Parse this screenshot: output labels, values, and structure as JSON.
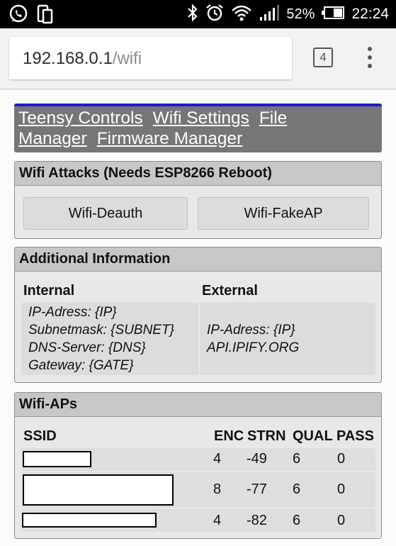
{
  "status_bar": {
    "left_icons": [
      "whatsapp-icon",
      "phone-device-icon"
    ],
    "right_icons": [
      "bluetooth-icon",
      "alarm-icon",
      "wifi-icon",
      "signal-icon"
    ],
    "battery_percent": "52%",
    "battery_level": 0.52,
    "time": "22:24"
  },
  "browser": {
    "url_host": "192.168.0.1",
    "url_path": "/wifi",
    "tab_count": "4"
  },
  "nav": {
    "links": [
      "Teensy Controls",
      "Wifi Settings",
      "File Manager",
      "Firmware Manager"
    ],
    "accent_color": "#1c1cd0"
  },
  "attacks": {
    "title": "Wifi Attacks (Needs ESP8266 Reboot)",
    "buttons": [
      "Wifi-Deauth",
      "Wifi-FakeAP"
    ]
  },
  "info": {
    "title": "Additional Information",
    "internal_header": "Internal",
    "external_header": "External",
    "internal": [
      "IP-Adress: {IP}",
      "Subnetmask: {SUBNET}",
      "DNS-Server: {DNS}",
      "Gateway: {GATE}"
    ],
    "external": [
      "IP-Adress: {IP}",
      "API.IPIFY.ORG"
    ]
  },
  "aps": {
    "title": "Wifi-APs",
    "columns": [
      "SSID",
      "ENC",
      "STRN",
      "QUAL",
      "PASS"
    ],
    "rows": [
      {
        "enc": "4",
        "strn": "-49",
        "qual": "6",
        "pass": "0"
      },
      {
        "enc": "8",
        "strn": "-77",
        "qual": "6",
        "pass": "0"
      },
      {
        "enc": "4",
        "strn": "-82",
        "qual": "6",
        "pass": "0"
      }
    ]
  }
}
